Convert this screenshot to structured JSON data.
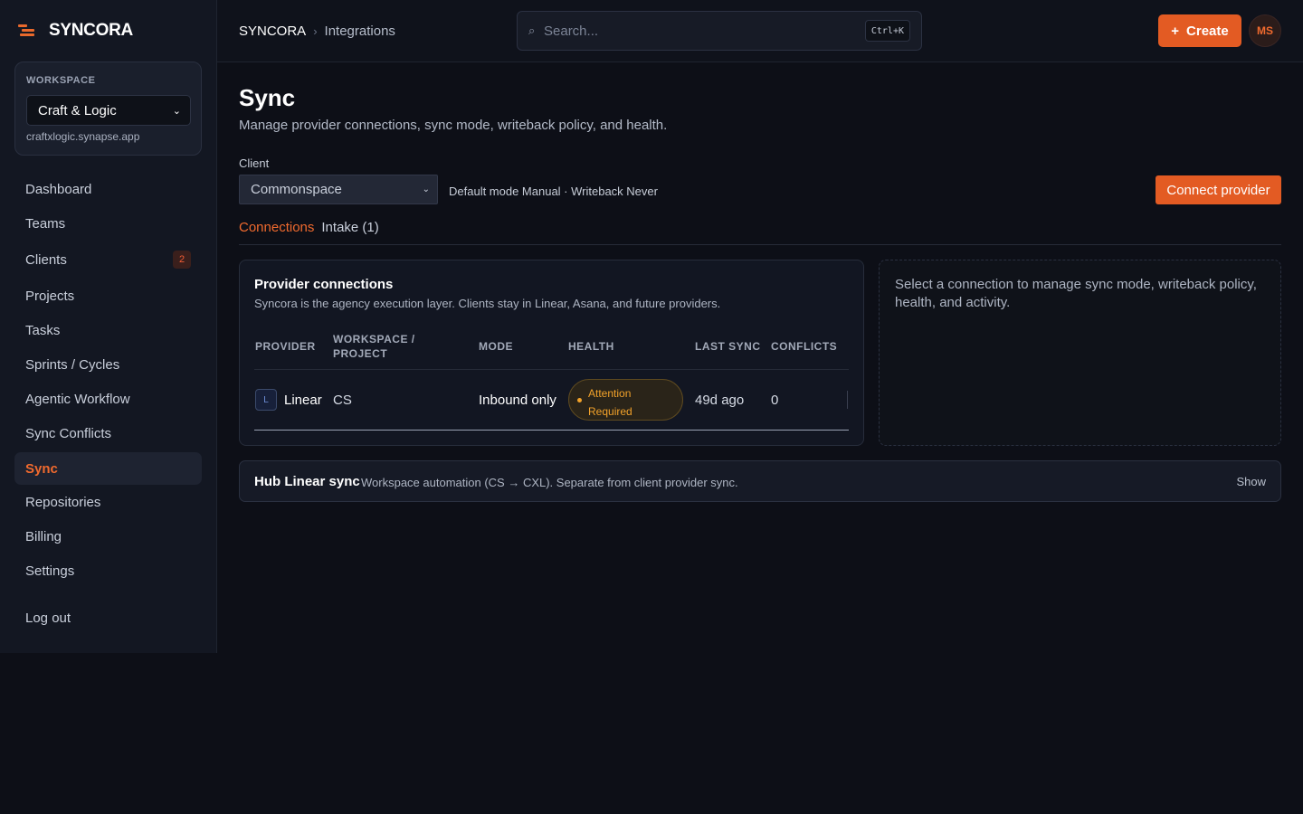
{
  "brand": {
    "name": "SYNCORA"
  },
  "workspace": {
    "label": "WORKSPACE",
    "selected": "Craft & Logic",
    "domain": "craftxlogic.synapse.app"
  },
  "sidebar": {
    "items": [
      {
        "label": "Dashboard"
      },
      {
        "label": "Teams"
      },
      {
        "label": "Clients",
        "badge": "2"
      },
      {
        "label": "Projects"
      },
      {
        "label": "Tasks"
      },
      {
        "label": "Sprints / Cycles"
      },
      {
        "label": "Agentic Workflow"
      },
      {
        "label": "Sync Conflicts"
      },
      {
        "label": "Sync",
        "active": true
      },
      {
        "label": "Repositories"
      },
      {
        "label": "Billing"
      },
      {
        "label": "Settings"
      }
    ],
    "logout": "Log out"
  },
  "topbar": {
    "breadcrumb": [
      "SYNCORA",
      "Integrations"
    ],
    "search_placeholder": "Search...",
    "search_shortcut": "Ctrl+K",
    "create_label": "Create",
    "avatar_initials": "MS"
  },
  "page": {
    "title": "Sync",
    "subtitle": "Manage provider connections, sync mode, writeback policy, and health.",
    "client_label": "Client",
    "client_selected": "Commonspace",
    "client_meta": "Default mode Manual · Writeback Never",
    "connect_label": "Connect provider",
    "tabs": [
      {
        "label": "Connections",
        "active": true
      },
      {
        "label": "Intake (1)"
      }
    ]
  },
  "connections": {
    "title": "Provider connections",
    "subtitle": "Syncora is the agency execution layer. Clients stay in Linear, Asana, and future providers.",
    "columns": [
      "PROVIDER",
      "WORKSPACE / PROJECT",
      "MODE",
      "HEALTH",
      "LAST SYNC",
      "CONFLICTS"
    ],
    "rows": [
      {
        "provider_icon": "L",
        "provider": "Linear",
        "workspace": "CS",
        "mode": "Inbound only",
        "health": "Attention Required",
        "last_sync": "49d ago",
        "conflicts": "0"
      }
    ]
  },
  "detail": {
    "placeholder": "Select a connection to manage sync mode, writeback policy, health, and activity."
  },
  "hub": {
    "title": "Hub Linear sync",
    "description": "Workspace automation (CS → CXL). Separate from client provider sync.",
    "toggle": "Show"
  },
  "colors": {
    "accent": "#e35b23",
    "background": "#0d0f17",
    "sidebar": "#131722",
    "warning": "#f2a22a"
  }
}
